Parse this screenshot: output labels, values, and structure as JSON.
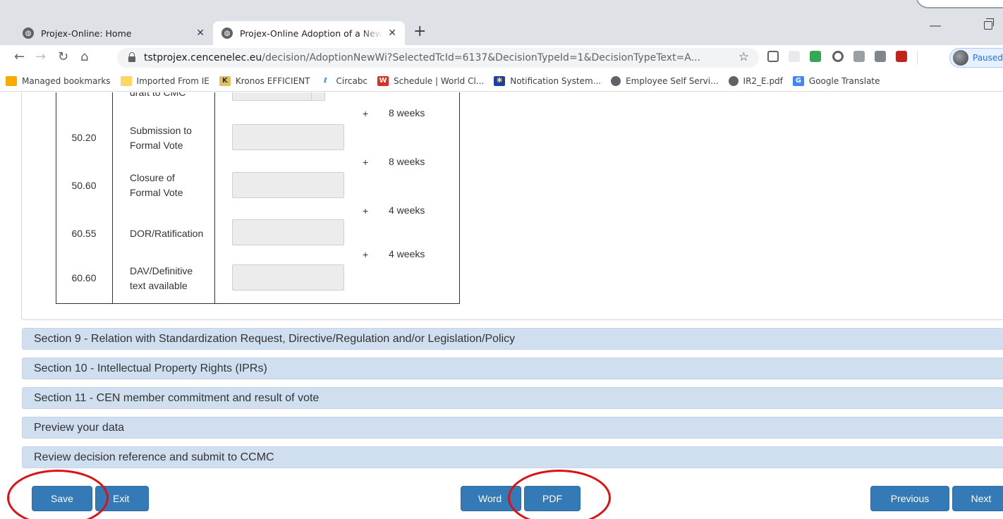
{
  "browser": {
    "tabs": [
      {
        "title": "Projex-Online: Home",
        "active": false
      },
      {
        "title": "Projex-Online Adoption of a New",
        "active": true
      }
    ],
    "new_tab": "+",
    "url_host": "tstprojex.cencenelec.eu",
    "url_path": "/decision/AdoptionNewWi?SelectedTcId=6137&DecisionTypeId=1&DecisionTypeText=A...",
    "profile_status": "Paused",
    "bookmarks": [
      {
        "label": "Managed bookmarks",
        "icon": "folder-icon"
      },
      {
        "label": "Imported From IE",
        "icon": "folder-icon"
      },
      {
        "label": "Kronos EFFICIENT",
        "icon": "kronos-icon"
      },
      {
        "label": "Circabc",
        "icon": "circabc-icon"
      },
      {
        "label": "Schedule | World Cl...",
        "icon": "schedule-icon"
      },
      {
        "label": "Notification System...",
        "icon": "eu-flag-icon"
      },
      {
        "label": "Employee Self Servi...",
        "icon": "globe-icon"
      },
      {
        "label": "IR2_E.pdf",
        "icon": "globe-icon"
      },
      {
        "label": "Google Translate",
        "icon": "translate-icon"
      }
    ]
  },
  "timeline": {
    "partial_row_label": "draft to CMC",
    "rows": [
      {
        "code": "50.20",
        "label": "Submission to Formal Vote",
        "label_l1": "Submission to",
        "label_l2": "Formal Vote",
        "value": ""
      },
      {
        "code": "50.60",
        "label": "Closure of Formal Vote",
        "label_l1": "Closure of",
        "label_l2": "Formal Vote",
        "value": ""
      },
      {
        "code": "60.55",
        "label": "DOR/Ratification",
        "label_l1": "DOR/Ratification",
        "label_l2": "",
        "value": ""
      },
      {
        "code": "60.60",
        "label": "DAV/Definitive text available",
        "label_l1": "DAV/Definitive",
        "label_l2": "text available",
        "value": ""
      }
    ],
    "durations": [
      {
        "plus": "+",
        "text": "8 weeks"
      },
      {
        "plus": "+",
        "text": "8 weeks"
      },
      {
        "plus": "+",
        "text": "4 weeks"
      },
      {
        "plus": "+",
        "text": "4 weeks"
      }
    ]
  },
  "sections": [
    "Section 9 - Relation with Standardization Request, Directive/Regulation and/or Legislation/Policy",
    "Section 10 - Intellectual Property Rights (IPRs)",
    "Section 11 - CEN member commitment and result of vote",
    "Preview your data",
    "Review decision reference and submit to CCMC"
  ],
  "actions": {
    "save": "Save",
    "exit": "Exit",
    "word": "Word",
    "pdf": "PDF",
    "previous": "Previous",
    "next": "Next"
  },
  "colors": {
    "primary_button": "#337ab7",
    "section_bar": "#cfdff0",
    "highlight_ellipse": "#e01010"
  }
}
